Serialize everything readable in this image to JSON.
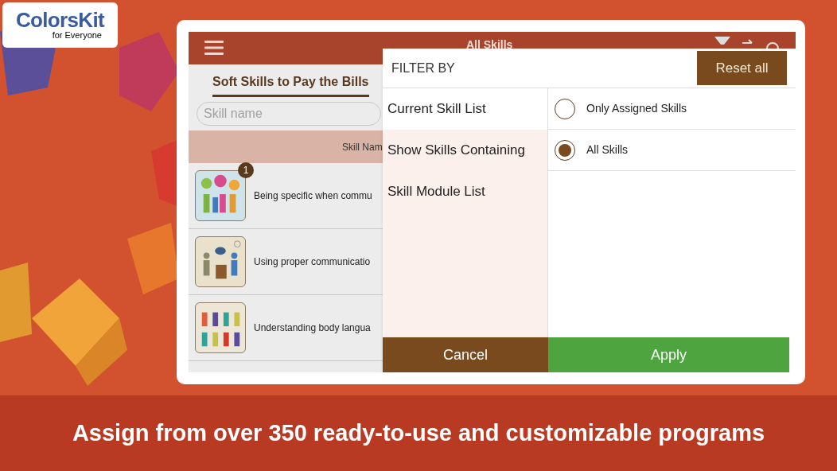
{
  "logo": {
    "name": "ColorsKit",
    "tagline": "for Everyone"
  },
  "app": {
    "title": "All Skills",
    "tabs": [
      {
        "label": "Soft Skills to Pay the Bills",
        "selected": true
      }
    ],
    "search": {
      "placeholder": "Skill name"
    },
    "table": {
      "columns": [
        "Skill Nam"
      ],
      "rows": [
        {
          "text": "Being specific when commu",
          "badge": "1"
        },
        {
          "text": "Using proper communicatio"
        },
        {
          "text": "Understanding body langua"
        }
      ]
    }
  },
  "filter": {
    "title": "FILTER BY",
    "reset_button": "Reset all",
    "categories": [
      {
        "label": "Current Skill List",
        "selected": true
      },
      {
        "label": "Show Skills Containing",
        "selected": false
      },
      {
        "label": "Skill Module List",
        "selected": false
      }
    ],
    "options": [
      {
        "label": "Only Assigned Skills",
        "selected": false
      },
      {
        "label": "All Skills",
        "selected": true
      }
    ],
    "buttons": [
      {
        "label": "Cancel",
        "kind": "cancel"
      },
      {
        "label": "Apply",
        "kind": "apply"
      }
    ]
  },
  "caption": "Assign from over 350 ready-to-use and customizable programs"
}
